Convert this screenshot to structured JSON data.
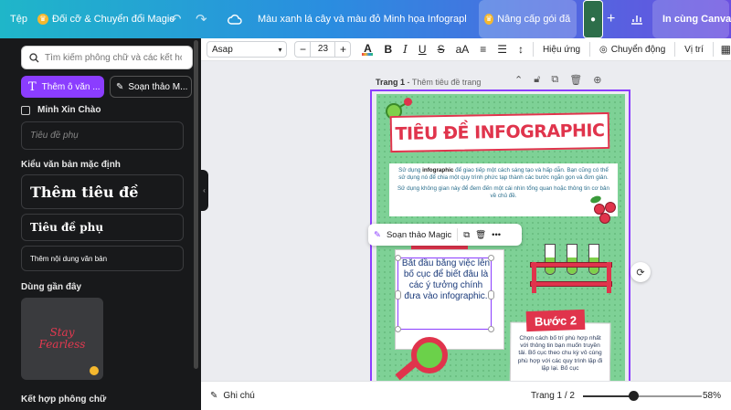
{
  "topbar": {
    "file": "Tệp",
    "magic_label": "Đối cỡ & Chuyển đổi Magic",
    "title": "Màu xanh lá cây và màu đỏ Minh họa Infographic quy ...",
    "upgrade_label": "Nâng cấp gói đăn...",
    "share_label": "In cùng Canva"
  },
  "sidebar": {
    "search_placeholder": "Tìm kiếm phông chữ và các kết hợp",
    "add_text_label": "Thêm ô văn ...",
    "magic_write_label": "Soạn thảo M...",
    "brand_name": "Minh Xin Chào",
    "subtitle_placeholder": "Tiêu đề phụ",
    "default_styles_label": "Kiểu văn bản mặc định",
    "add_heading": "Thêm tiêu đề",
    "add_subheading": "Tiêu đề phụ",
    "add_body": "Thêm nội dung văn bản",
    "recent_label": "Dùng gần đây",
    "recent_thumb_text": "Stay Fearless",
    "font_combos_label": "Kết hợp phông chữ"
  },
  "format_toolbar": {
    "font": "Asap",
    "size": "23",
    "effects": "Hiệu ứng",
    "animate": "Chuyển động",
    "position": "Vị trí"
  },
  "canvas": {
    "page_label": "Trang 1",
    "page_title": "Thêm tiêu đề trang",
    "float_magic": "Soạn thảo Magic",
    "infographic": {
      "title": "TIÊU ĐỀ INFOGRAPHIC",
      "intro_p1_pre": "Sử dụng ",
      "intro_p1_bold": "infographic",
      "intro_p1_post": " để giao tiếp một cách sáng tạo và hấp dẫn. Bạn cũng có thể sử dụng nó để chia một quy trình phức tạp thành các bước ngắn gọn và đơn giản.",
      "intro_p2": "Sử dụng không gian này để đem đến một cái nhìn tổng quan hoặc thông tin cơ bản về chủ đề.",
      "step1_text": "Bắt đầu bằng việc lên bố cục để biết đâu là các ý tưởng chính đưa vào infographic.",
      "step2_label": "Bước 2",
      "step2_text": "Chọn cách bố trí phù hợp nhất với thông tin bạn muốn truyền tải. Bố cục theo chu kỳ vô cùng phù hợp với các quy trình lặp đi lặp lại. Bố cục"
    }
  },
  "bottombar": {
    "notes": "Ghi chú",
    "page_indicator": "Trang 1 / 2",
    "zoom_label": "58%",
    "zoom_level": 0.42
  },
  "colors": {
    "accent": "#8b3dff",
    "infographic_red": "#e0344c",
    "infographic_green": "#7ed196"
  }
}
